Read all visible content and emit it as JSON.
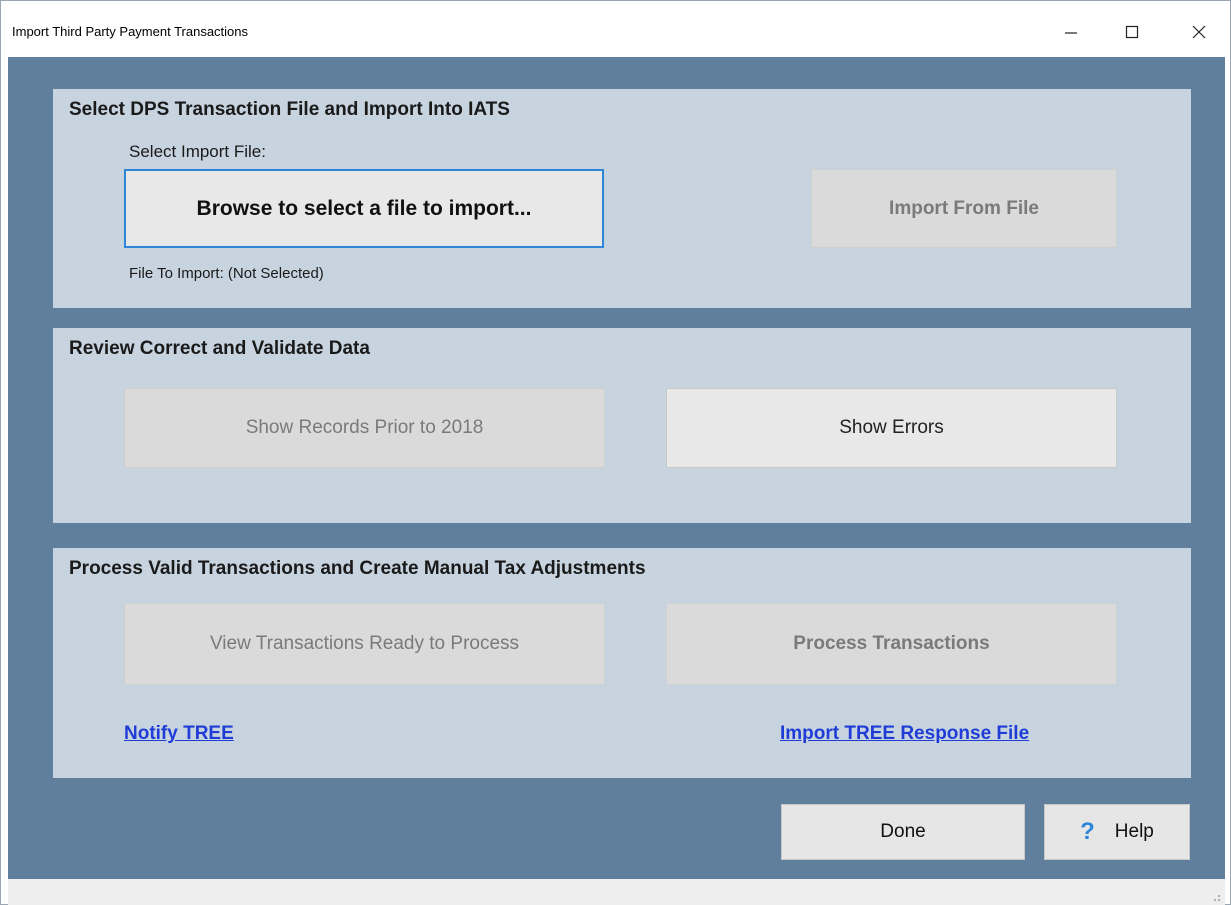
{
  "window": {
    "title": "Import Third Party Payment Transactions"
  },
  "section1": {
    "title": "Select DPS Transaction File and Import Into IATS",
    "select_label": "Select Import File:",
    "browse_button": "Browse to select a file to import...",
    "import_button": "Import From File",
    "file_status": "File To Import: (Not Selected)"
  },
  "section2": {
    "title": "Review Correct and Validate Data",
    "show_prior_button": "Show Records Prior to 2018",
    "show_errors_button": "Show Errors"
  },
  "section3": {
    "title": "Process Valid Transactions and Create Manual Tax Adjustments",
    "view_ready_button": "View Transactions Ready to Process",
    "process_button": "Process Transactions",
    "notify_link": "Notify TREE",
    "import_response_link": "Import TREE Response File"
  },
  "footer": {
    "done_button": "Done",
    "help_button": "Help",
    "help_icon_glyph": "?"
  },
  "colors": {
    "client_bg": "#5f7f9c",
    "panel_bg": "#c7d4e0",
    "link": "#1f3dd6",
    "focus_border": "#2f86d8"
  }
}
